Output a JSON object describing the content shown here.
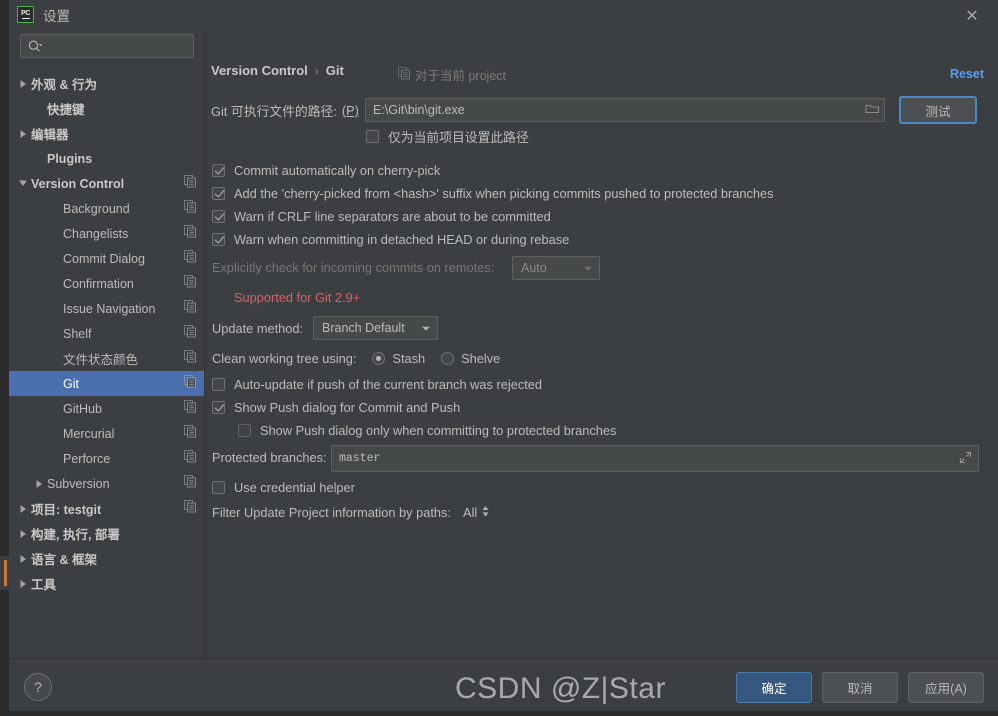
{
  "window": {
    "title": "设置",
    "app_icon": "pycharm-icon",
    "app_icon_text": "PC",
    "close_icon": "close-icon"
  },
  "sidebar": {
    "search": {
      "placeholder": "",
      "value": "",
      "icon": "search-icon"
    },
    "items": [
      {
        "label": "外观 & 行为",
        "indent": 0,
        "arrow": "right",
        "bold": true,
        "copy": false,
        "selected": false
      },
      {
        "label": "快捷键",
        "indent": 1,
        "arrow": "none",
        "bold": true,
        "copy": false,
        "selected": false
      },
      {
        "label": "编辑器",
        "indent": 0,
        "arrow": "right",
        "bold": true,
        "copy": false,
        "selected": false
      },
      {
        "label": "Plugins",
        "indent": 1,
        "arrow": "none",
        "bold": true,
        "copy": false,
        "selected": false
      },
      {
        "label": "Version Control",
        "indent": 0,
        "arrow": "down",
        "bold": true,
        "copy": true,
        "selected": false
      },
      {
        "label": "Background",
        "indent": 2,
        "arrow": "none",
        "bold": false,
        "copy": true,
        "selected": false
      },
      {
        "label": "Changelists",
        "indent": 2,
        "arrow": "none",
        "bold": false,
        "copy": true,
        "selected": false
      },
      {
        "label": "Commit Dialog",
        "indent": 2,
        "arrow": "none",
        "bold": false,
        "copy": true,
        "selected": false
      },
      {
        "label": "Confirmation",
        "indent": 2,
        "arrow": "none",
        "bold": false,
        "copy": true,
        "selected": false
      },
      {
        "label": "Issue Navigation",
        "indent": 2,
        "arrow": "none",
        "bold": false,
        "copy": true,
        "selected": false
      },
      {
        "label": "Shelf",
        "indent": 2,
        "arrow": "none",
        "bold": false,
        "copy": true,
        "selected": false
      },
      {
        "label": "文件状态颜色",
        "indent": 2,
        "arrow": "none",
        "bold": false,
        "copy": true,
        "selected": false
      },
      {
        "label": "Git",
        "indent": 2,
        "arrow": "none",
        "bold": false,
        "copy": true,
        "selected": true
      },
      {
        "label": "GitHub",
        "indent": 2,
        "arrow": "none",
        "bold": false,
        "copy": true,
        "selected": false
      },
      {
        "label": "Mercurial",
        "indent": 2,
        "arrow": "none",
        "bold": false,
        "copy": true,
        "selected": false
      },
      {
        "label": "Perforce",
        "indent": 2,
        "arrow": "none",
        "bold": false,
        "copy": true,
        "selected": false
      },
      {
        "label": "Subversion",
        "indent": 1,
        "arrow": "right",
        "bold": false,
        "copy": true,
        "selected": false
      },
      {
        "label": "项目: testgit",
        "indent": 0,
        "arrow": "right",
        "bold": true,
        "copy": true,
        "selected": false
      },
      {
        "label": "构建, 执行, 部署",
        "indent": 0,
        "arrow": "right",
        "bold": true,
        "copy": false,
        "selected": false
      },
      {
        "label": "语言 & 框架",
        "indent": 0,
        "arrow": "right",
        "bold": true,
        "copy": false,
        "selected": false
      },
      {
        "label": "工具",
        "indent": 0,
        "arrow": "right",
        "bold": true,
        "copy": false,
        "selected": false
      }
    ]
  },
  "main": {
    "breadcrumb": {
      "parent": "Version Control",
      "separator": "›",
      "current": "Git"
    },
    "scope_note": "对于当前 project",
    "reset_label": "Reset",
    "git_path": {
      "label_prefix": "Git 可执行文件的路径:",
      "mnemonic": "(P)",
      "value": "E:\\Git\\bin\\git.exe",
      "browse_icon": "folder-icon"
    },
    "test_button": "测试",
    "project_path_only": {
      "label": "仅为当前项目设置此路径",
      "checked": false
    },
    "checkboxes": [
      {
        "label": "Commit automatically on cherry-pick",
        "checked": true
      },
      {
        "label": "Add the 'cherry-picked from <hash>' suffix when picking commits pushed to protected branches",
        "checked": true
      },
      {
        "label": "Warn if CRLF line separators are about to be committed",
        "checked": true
      },
      {
        "label": "Warn when committing in detached HEAD or during rebase",
        "checked": true
      }
    ],
    "incoming_commits": {
      "label": "Explicitly check for incoming commits on remotes:",
      "value": "Auto",
      "disabled": true
    },
    "supported_note": "Supported for Git 2.9+",
    "update_method": {
      "label": "Update method:",
      "value": "Branch Default"
    },
    "clean_working_tree": {
      "label": "Clean working tree using:",
      "options": [
        {
          "label": "Stash",
          "selected": true
        },
        {
          "label": "Shelve",
          "selected": false
        }
      ]
    },
    "auto_update": {
      "label": "Auto-update if push of the current branch was rejected",
      "checked": false
    },
    "show_push_dialog": {
      "label": "Show Push dialog for Commit and Push",
      "checked": true
    },
    "show_push_dialog_protected": {
      "label": "Show Push dialog only when committing to protected branches",
      "checked": false
    },
    "protected_branches": {
      "label": "Protected branches:",
      "value": "master",
      "expand_icon": "expand-icon"
    },
    "credential_helper": {
      "label": "Use credential helper",
      "checked": false
    },
    "filter_paths": {
      "label": "Filter Update Project information by paths:",
      "value": "All"
    }
  },
  "footer": {
    "help_label": "?",
    "buttons": [
      {
        "label": "确定",
        "style": "default"
      },
      {
        "label": "取消",
        "style": "normal"
      },
      {
        "label": "应用(A)",
        "style": "normal"
      }
    ]
  },
  "watermark": "CSDN @Z|Star",
  "colors": {
    "accent_blue": "#4b6eaf",
    "link_blue": "#589df6",
    "default_button": "#365880",
    "warning_red": "#d9606a",
    "panel_bg": "#3c3f41",
    "field_bg": "#45494a"
  }
}
